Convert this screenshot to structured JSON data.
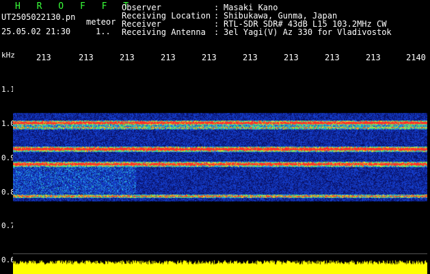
{
  "header": {
    "brand": "H R O F F T",
    "file_name": "UT2505022130.pn",
    "mode": "meteor",
    "timestamp": "25.05.02 21:30",
    "duration_mark": "1.."
  },
  "station": [
    {
      "label": "Observer",
      "value": "Masaki Kano"
    },
    {
      "label": "Receiving Location",
      "value": "Shibukawa, Gunma, Japan"
    },
    {
      "label": "Receiver",
      "value": "RTL-SDR SDR# 43dB L15 103.2MHz CW"
    },
    {
      "label": "Receiving Antenna",
      "value": "3el Yagi(V) Az 330 for Vladivostok"
    }
  ],
  "separator": ":",
  "time_axis": {
    "ticks": [
      "213",
      "213",
      "213",
      "213",
      "213",
      "213",
      "213",
      "213",
      "213",
      "2140"
    ]
  },
  "freq_axis": {
    "unit": "kHz",
    "ticks": [
      "1.1",
      "1.0",
      "0.9",
      "0.8",
      "0.7",
      "0.6"
    ]
  },
  "colors": {
    "brand": "#39ff39",
    "background": "#000000",
    "level_strip": "#ffff00",
    "spectrogram_low": "#0a1a7a",
    "spectrogram_high": "#ff3030"
  }
}
